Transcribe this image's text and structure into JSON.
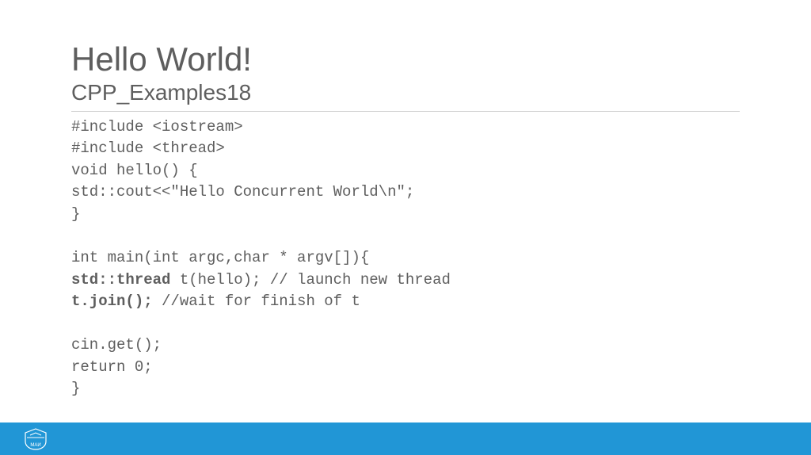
{
  "title": "Hello World!",
  "subtitle": "CPP_Examples18",
  "code": {
    "line1": "#include <iostream>",
    "line2": "#include <thread>",
    "line3": "void hello() {",
    "line4": "std::cout<<\"Hello Concurrent World\\n\";",
    "line5": "}",
    "line6": "",
    "line7": "int main(int argc,char * argv[]){",
    "line8_bold": "std::thread ",
    "line8_rest": "t(hello); // launch new thread",
    "line9_bold": "t.join();",
    "line9_rest": " //wait for finish of t",
    "line10": "",
    "line11": "cin.get();",
    "line12": "return 0;",
    "line13": "}"
  },
  "footer": {
    "logo_label": "МАИ"
  }
}
